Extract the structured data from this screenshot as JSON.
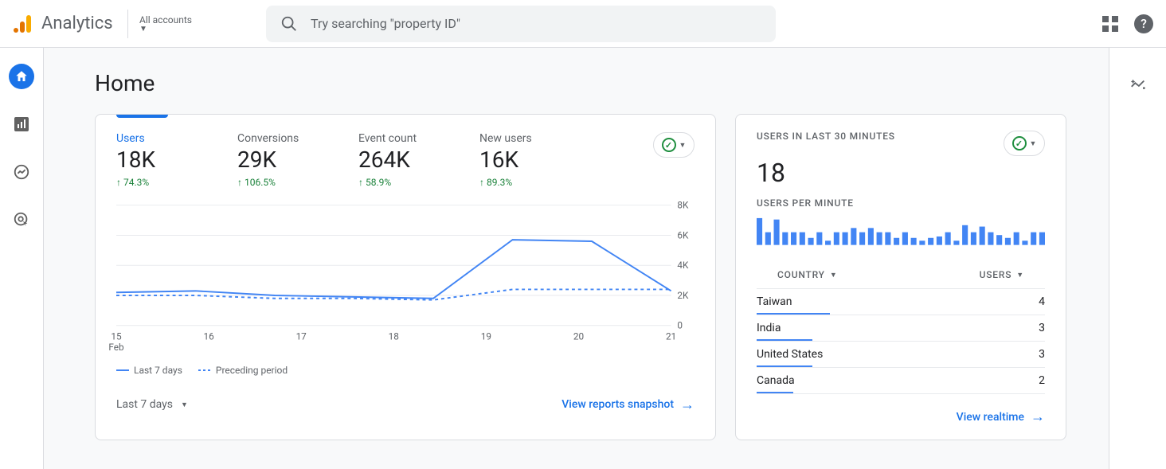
{
  "header": {
    "app_title": "Analytics",
    "accounts_label": "All accounts",
    "search_placeholder": "Try searching \"property ID\""
  },
  "page": {
    "title": "Home"
  },
  "metrics_card": {
    "metrics": [
      {
        "label": "Users",
        "value": "18K",
        "change": "74.3%",
        "active": true
      },
      {
        "label": "Conversions",
        "value": "29K",
        "change": "106.5%",
        "active": false
      },
      {
        "label": "Event count",
        "value": "264K",
        "change": "58.9%",
        "active": false
      },
      {
        "label": "New users",
        "value": "16K",
        "change": "89.3%",
        "active": false
      }
    ],
    "range_label": "Last 7 days",
    "legend_current": "Last 7 days",
    "legend_prev": "Preceding period",
    "view_link": "View reports snapshot",
    "x_month": "Feb"
  },
  "realtime_card": {
    "title": "USERS IN LAST 30 MINUTES",
    "value": "18",
    "subtitle": "USERS PER MINUTE",
    "country_header": "COUNTRY",
    "users_header": "USERS",
    "countries": [
      {
        "name": "Taiwan",
        "users": 4,
        "bar": 92
      },
      {
        "name": "India",
        "users": 3,
        "bar": 70
      },
      {
        "name": "United States",
        "users": 3,
        "bar": 70
      },
      {
        "name": "Canada",
        "users": 2,
        "bar": 46
      }
    ],
    "view_link": "View realtime"
  },
  "chart_data": {
    "type": "line",
    "xlabel": "",
    "ylabel": "",
    "ylim": [
      0,
      8000
    ],
    "y_ticks": [
      "0",
      "2K",
      "4K",
      "6K",
      "8K"
    ],
    "categories": [
      "15",
      "16",
      "17",
      "18",
      "19",
      "20",
      "21"
    ],
    "series": [
      {
        "name": "Last 7 days",
        "style": "solid",
        "values": [
          2200,
          2300,
          2000,
          1900,
          1800,
          5700,
          5600,
          2300
        ]
      },
      {
        "name": "Preceding period",
        "style": "dash",
        "values": [
          2000,
          2000,
          1800,
          1800,
          1700,
          2400,
          2400,
          2400
        ]
      }
    ],
    "spark": {
      "type": "bar",
      "values": [
        38,
        18,
        36,
        18,
        18,
        18,
        10,
        18,
        6,
        18,
        18,
        24,
        18,
        24,
        18,
        18,
        10,
        18,
        10,
        6,
        10,
        12,
        18,
        6,
        28,
        18,
        26,
        18,
        14,
        10,
        18,
        6,
        18,
        18
      ]
    }
  }
}
